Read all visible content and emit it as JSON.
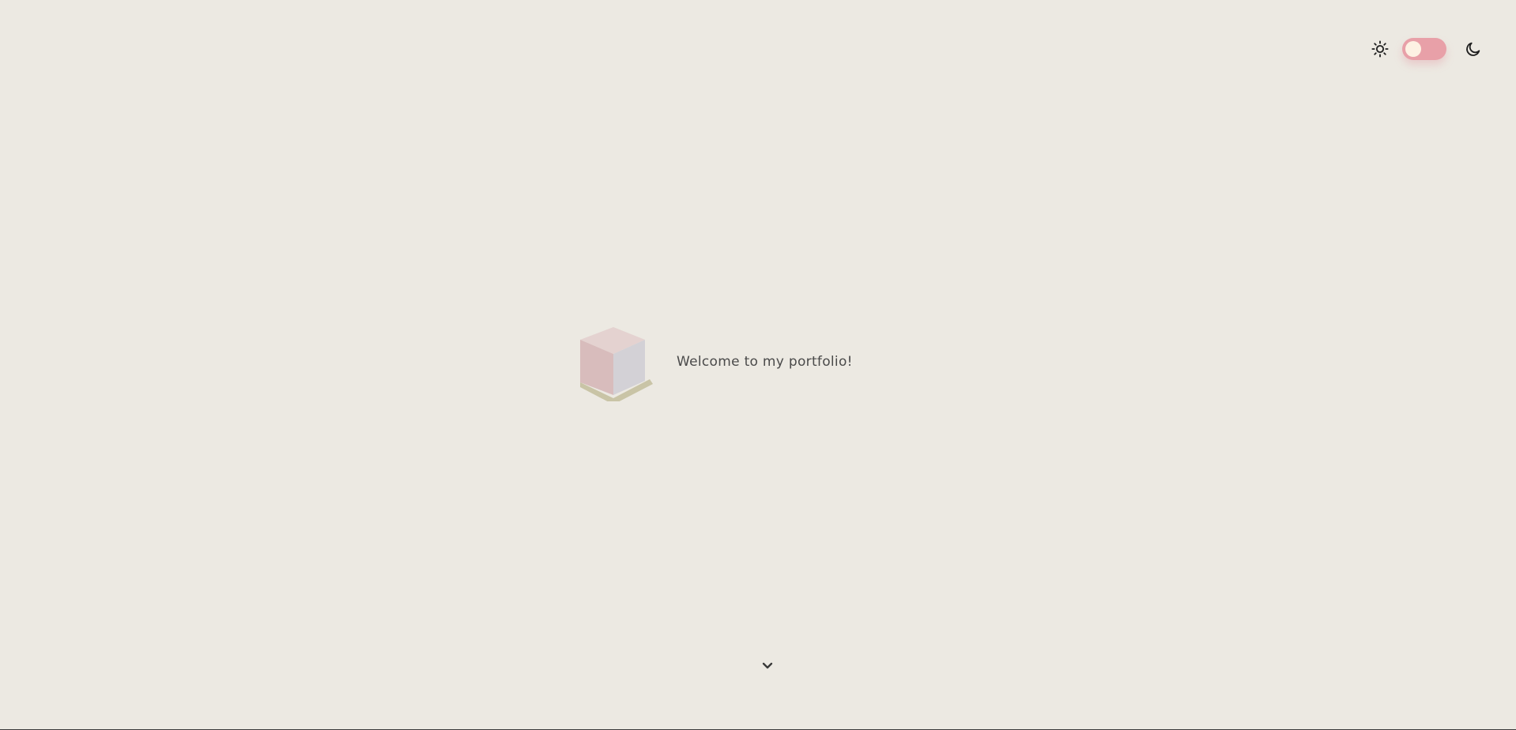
{
  "theme": {
    "light_icon": "sun-icon",
    "dark_icon": "moon-icon",
    "mode": "light",
    "toggle_color": "#e8a0a8",
    "knob_color": "#fdf1e3"
  },
  "hero": {
    "logo": "cube-logo",
    "welcome_text": "Welcome to my portfolio!"
  },
  "scroll": {
    "icon": "chevron-down-icon"
  },
  "colors": {
    "background": "#ece9e2",
    "text": "#4a4a4a",
    "cube_top": "#e4d2d0",
    "cube_left": "#d8bcbc",
    "cube_right": "#d3d1d6",
    "cube_shadow": "#c9c4a6"
  }
}
